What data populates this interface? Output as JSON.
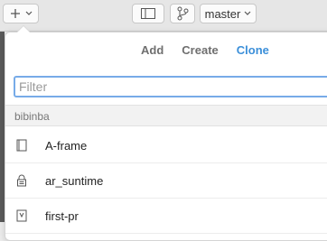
{
  "toolbar": {
    "add_icon": "plus-icon",
    "add_caret": "chevron-down-icon",
    "sidebar_icon": "sidebar-toggle-icon",
    "branch_icon": "branch-icon",
    "branch_name": "master"
  },
  "popover": {
    "tabs": [
      {
        "label": "Add",
        "active": false
      },
      {
        "label": "Create",
        "active": false
      },
      {
        "label": "Clone",
        "active": true
      }
    ],
    "filter": {
      "placeholder": "Filter",
      "value": ""
    },
    "section_title": "bibinba",
    "repos": [
      {
        "name": "A-frame",
        "icon": "book-icon"
      },
      {
        "name": "ar_suntime",
        "icon": "lock-icon"
      },
      {
        "name": "first-pr",
        "icon": "fork-icon"
      }
    ]
  },
  "colors": {
    "accent": "#3b8fd9",
    "tab_inactive": "#6f6f6f",
    "focus_ring": "#77abe8"
  }
}
